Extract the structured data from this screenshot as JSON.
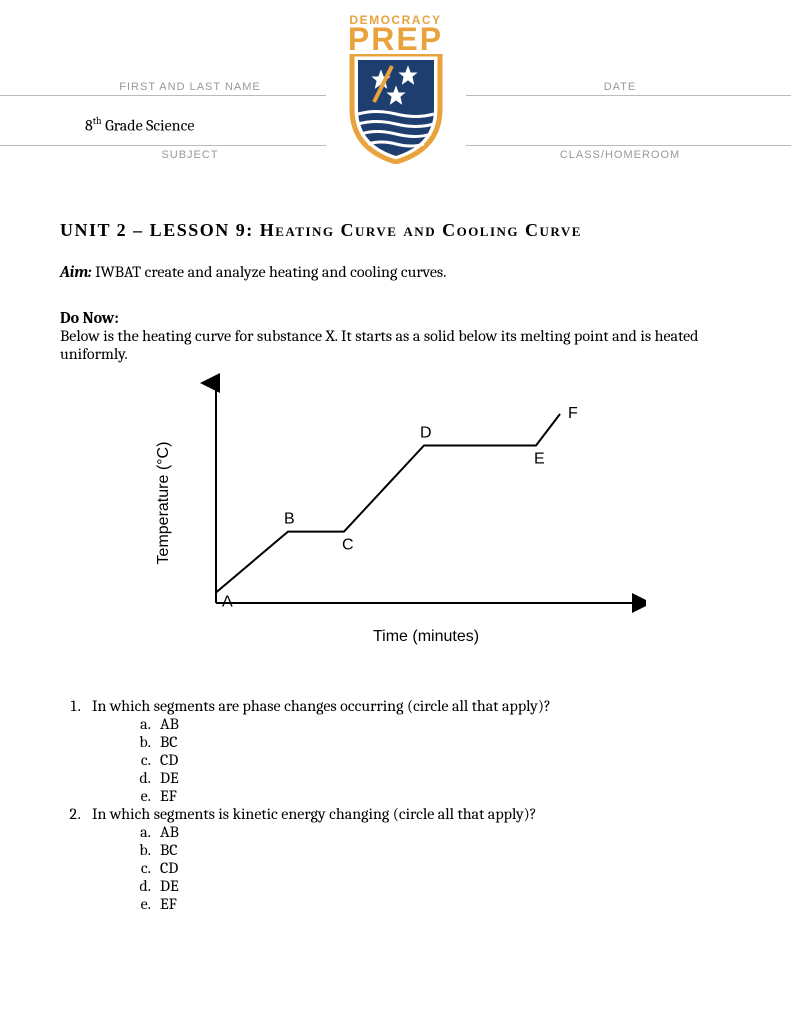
{
  "logo": {
    "top": "DEMOCRACY",
    "main": "PREP"
  },
  "header": {
    "name_label": "FIRST AND LAST NAME",
    "date_label": "DATE",
    "subject_label": "SUBJECT",
    "class_label": "CLASS/HOMEROOM",
    "subject_value_prefix": "8",
    "subject_value_suffix": "th",
    "subject_value_rest": " Grade Science"
  },
  "title": "UNIT 2 – LESSON 9: Heating Curve and Cooling Curve",
  "aim": {
    "label": "Aim:",
    "text": " IWBAT create and analyze heating and cooling curves."
  },
  "donow": {
    "label": "Do Now:",
    "text": "Below is the heating curve for substance X. It starts as a solid below its melting point and is heated uniformly."
  },
  "chart_data": {
    "type": "line",
    "title": "",
    "xlabel": "Time (minutes)",
    "ylabel": "Temperature (°C)",
    "points": [
      {
        "label": "A",
        "x": 0,
        "y": 5
      },
      {
        "label": "B",
        "x": 18,
        "y": 34
      },
      {
        "label": "C",
        "x": 32,
        "y": 34
      },
      {
        "label": "D",
        "x": 52,
        "y": 75
      },
      {
        "label": "E",
        "x": 80,
        "y": 75
      },
      {
        "label": "F",
        "x": 86,
        "y": 90
      }
    ],
    "xlim": [
      0,
      100
    ],
    "ylim": [
      0,
      100
    ]
  },
  "questions": [
    {
      "text": "In which segments are phase changes occurring (circle all that apply)?",
      "options": [
        "AB",
        "BC",
        "CD",
        "DE",
        "EF"
      ]
    },
    {
      "text": "In which segments is kinetic energy changing (circle all that apply)?",
      "options": [
        "AB",
        "BC",
        "CD",
        "DE",
        "EF"
      ]
    }
  ]
}
